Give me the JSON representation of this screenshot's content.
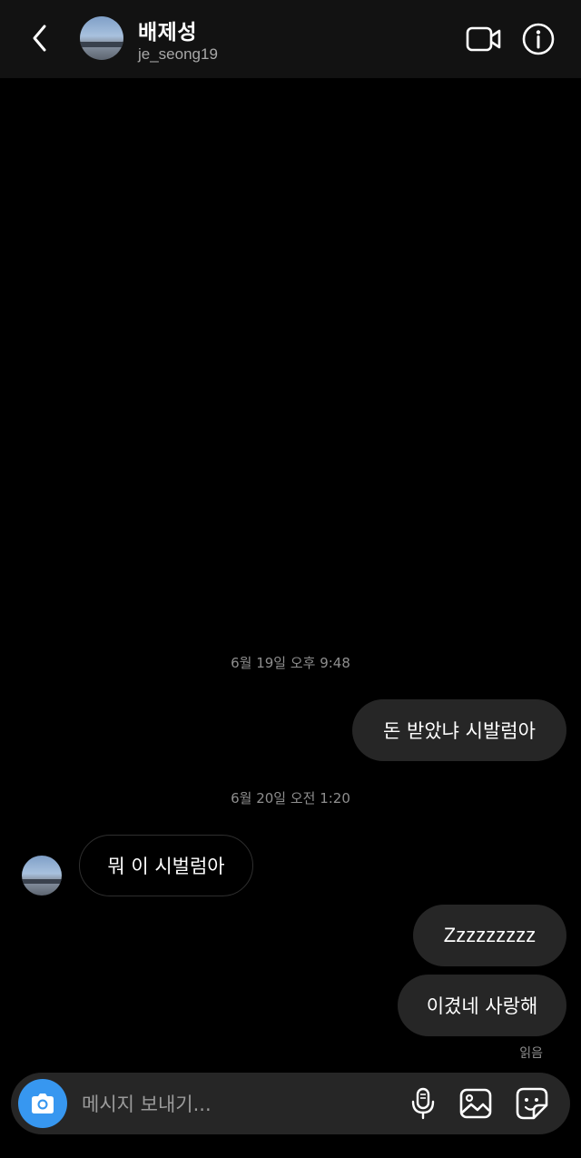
{
  "header": {
    "name": "배제성",
    "username": "je_seong19",
    "icons": {
      "back": "chevron-left-icon",
      "video": "video-call-icon",
      "info": "info-icon"
    }
  },
  "conversation": {
    "timestamps": [
      "6월 19일 오후 9:48",
      "6월 20일 오전 1:20"
    ],
    "messages": [
      {
        "direction": "sent",
        "text": "돈 받았냐 시발럼아"
      },
      {
        "direction": "received",
        "text": "뭐 이 시벌럼아"
      },
      {
        "direction": "sent",
        "text": "Zzzzzzzzz"
      },
      {
        "direction": "sent",
        "text": "이겼네 사랑해"
      }
    ],
    "read_status": "읽음"
  },
  "composer": {
    "placeholder": "메시지 보내기...",
    "value": "",
    "icons": {
      "camera": "camera-icon",
      "mic": "microphone-icon",
      "gallery": "gallery-icon",
      "sticker": "sticker-icon"
    }
  },
  "colors": {
    "background": "#000000",
    "header_bg": "#121212",
    "sent_bubble": "#262626",
    "camera_accent": "#3797f0",
    "muted_text": "#8e8e8e"
  }
}
